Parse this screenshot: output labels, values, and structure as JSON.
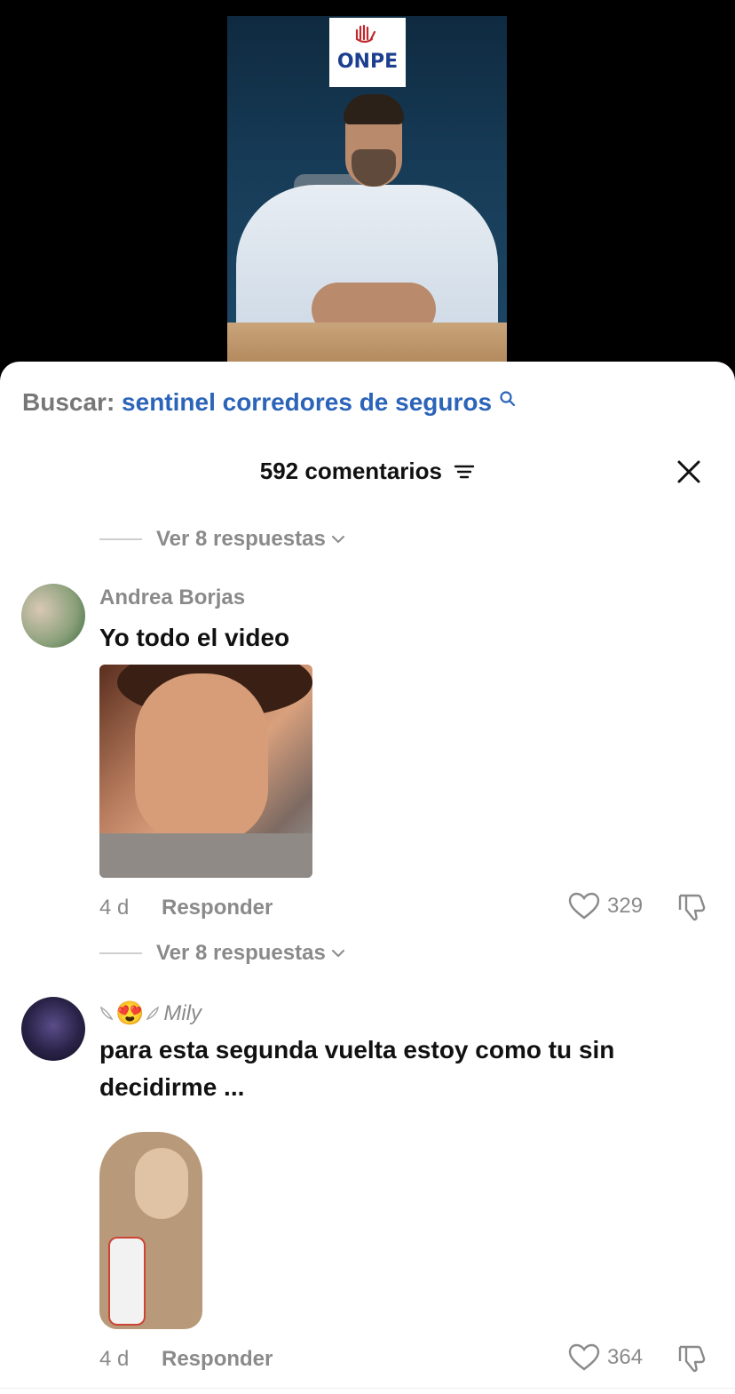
{
  "video": {
    "logo_text": "ONPE"
  },
  "search": {
    "label": "Buscar:",
    "query": "sentinel corredores de seguros"
  },
  "comments_header": {
    "count_label": "592 comentarios"
  },
  "replies_top": {
    "label": "Ver 8 respuestas"
  },
  "comments": [
    {
      "username": "Andrea Borjas",
      "text": "Yo todo el video",
      "age": "4 d",
      "reply_label": "Responder",
      "likes": "329",
      "replies_label": "Ver 8 respuestas"
    },
    {
      "username": "Mily",
      "emoji": "😍",
      "text": "para esta segunda vuelta estoy como tu sin decidirme ...",
      "age": "4 d",
      "reply_label": "Responder",
      "likes": "364"
    }
  ],
  "colors": {
    "accent_blue": "#2b64b8",
    "muted_gray": "#8a8a8a",
    "text_dark": "#111111"
  }
}
